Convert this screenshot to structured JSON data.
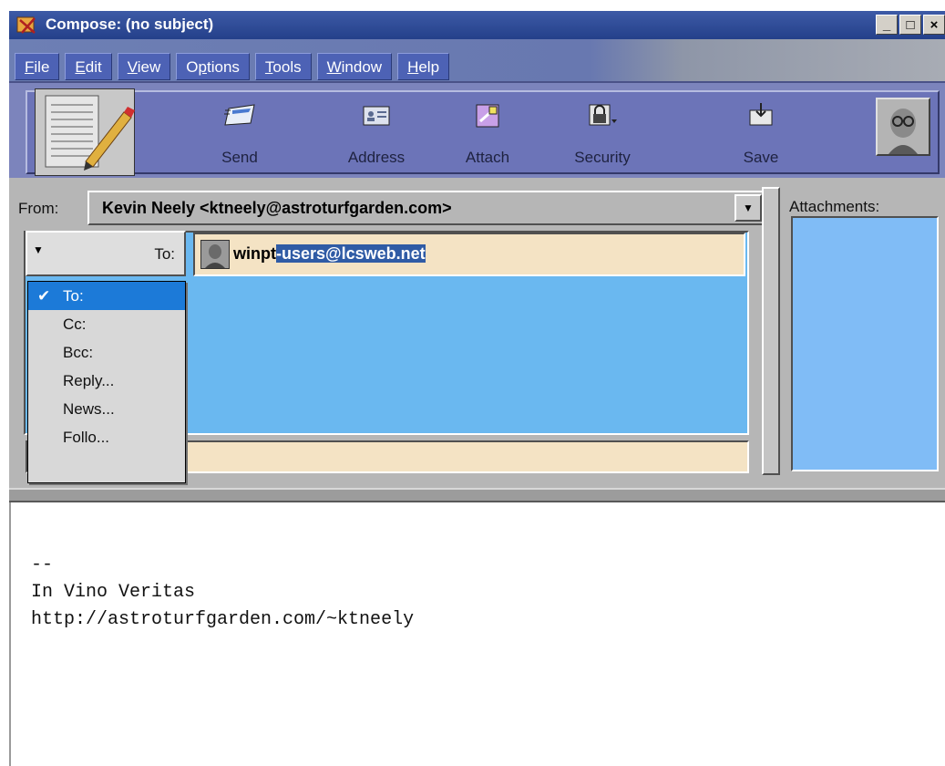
{
  "window": {
    "title": "Compose: (no subject)",
    "controls": [
      "_",
      "□",
      "×"
    ]
  },
  "menu": [
    {
      "label": "File",
      "mnemonic": "F"
    },
    {
      "label": "Edit",
      "mnemonic": "E"
    },
    {
      "label": "View",
      "mnemonic": "V"
    },
    {
      "label": "Options",
      "mnemonic": "p"
    },
    {
      "label": "Tools",
      "mnemonic": "T"
    },
    {
      "label": "Window",
      "mnemonic": "W"
    },
    {
      "label": "Help",
      "mnemonic": "H"
    }
  ],
  "toolbar": {
    "send": "Send",
    "address": "Address",
    "attach": "Attach",
    "security": "Security",
    "save": "Save"
  },
  "from": {
    "label": "From:",
    "value": "Kevin Neely <ktneely@astroturfgarden.com>"
  },
  "recipient": {
    "type_label": "To:",
    "address_plain": "winpt",
    "address_selected": "-users@lcsweb.net"
  },
  "recipient_types": [
    {
      "label": "To:",
      "checked": true
    },
    {
      "label": "Cc:",
      "checked": false
    },
    {
      "label": "Bcc:",
      "checked": false
    },
    {
      "label": "Reply...",
      "checked": false
    },
    {
      "label": "News...",
      "checked": false
    },
    {
      "label": "Follo...",
      "checked": false
    }
  ],
  "attachments": {
    "label": "Attachments:"
  },
  "body": {
    "text": "--\nIn Vino Veritas\nhttp://astroturfgarden.com/~ktneely"
  },
  "colors": {
    "titlebar": "#24408a",
    "menu_item": "#4d62b5",
    "toolbar": "#6c74b8",
    "recipient_area": "#6ab8f0",
    "field_bg": "#f4e3c4",
    "selection": "#2f5ba5",
    "dropdown_highlight": "#1c7ad8"
  }
}
